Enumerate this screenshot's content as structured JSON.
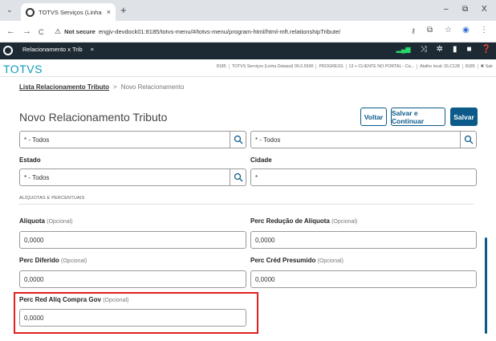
{
  "browser": {
    "tab_title": "TOTVS Serviços (Linha Datasul)",
    "tab_close": "×",
    "new_tab": "+",
    "tab_list": "⌄",
    "window_minimize": "–",
    "window_restore": "⧉",
    "window_close": "X",
    "back": "←",
    "forward": "→",
    "reload": "C",
    "not_secure_label": "Not secure",
    "url": "engjv-devdock01:8185/totvs-menu/#/totvs-menu/program-html/html-mft.relationshipTribute/",
    "icons": [
      "warning-icon",
      "password-key-icon",
      "translate-icon",
      "star-icon",
      "profile-icon",
      "kebab-menu-icon"
    ]
  },
  "app_header": {
    "tab_label": "Relacionamento x Trib",
    "tab_close": "×",
    "icons": [
      "signal-icon",
      "shuffle-icon",
      "settings-icon",
      "notebook-icon",
      "chat-icon",
      "help-icon"
    ]
  },
  "totvs_bar": {
    "logo": "TOTVS",
    "info": [
      "8185",
      "TOTVS Serviços (Linha Datasul) 06.0.5500",
      "PROGRESS",
      "13 + CLIENTE NO PORTAL - Ca...",
      "Atalho local: DLC128",
      "8185",
      "✖ Sair"
    ]
  },
  "breadcrumb": {
    "link": "Lista Relacionamento Tributo",
    "separator": ">",
    "current": "Novo Relacionamento"
  },
  "page": {
    "title": "Novo Relacionamento Tributo",
    "buttons": {
      "back": "Voltar",
      "save_continue": "Salvar e Continuar",
      "save": "Salvar"
    }
  },
  "form": {
    "top_left_value": "* - Todos",
    "top_right_value": "* - Todos",
    "estado": {
      "label": "Estado",
      "value": "* - Todos"
    },
    "cidade": {
      "label": "Cidade",
      "value": "*"
    },
    "section_title": "ALÍQUOTAS E PERCENTUAIS",
    "aliquota": {
      "label": "Alíquota",
      "optional": "(Opcional)",
      "value": "0,0000"
    },
    "perc_reducao": {
      "label": "Perc Redução de Alíquota",
      "optional": "(Opcional)",
      "value": "0,0000"
    },
    "perc_diferido": {
      "label": "Perc Diferido",
      "optional": "(Opcional)",
      "value": "0,0000"
    },
    "perc_cred_presumido": {
      "label": "Perc Créd Presumido",
      "optional": "(Opcional)",
      "value": "0,0000"
    },
    "perc_red_aliq_compra_gov": {
      "label": "Perc Red Alíq Compra Gov",
      "optional": "(Opcional)",
      "value": "0,0000"
    }
  },
  "colors": {
    "brand": "#0c9abe",
    "primary": "#0c5a8a",
    "header_dark": "#1e2a33",
    "highlight": "#e0201f"
  }
}
